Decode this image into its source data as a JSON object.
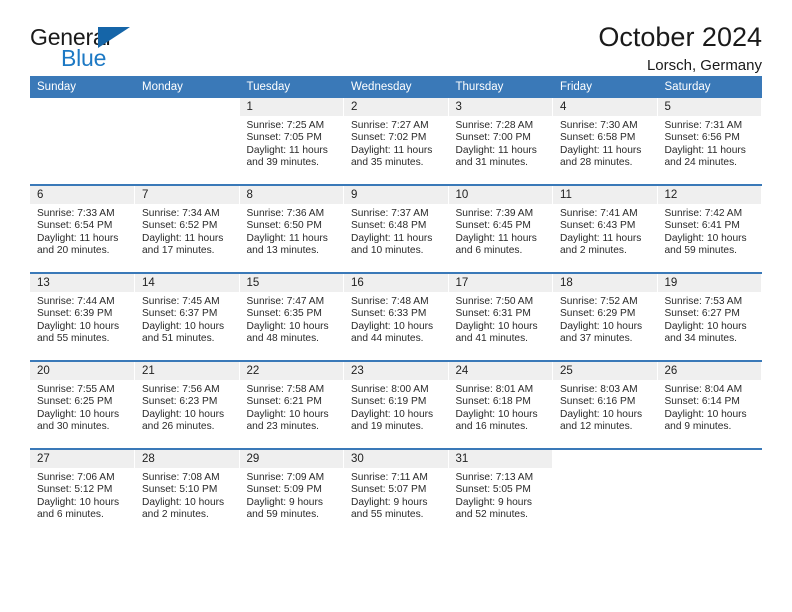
{
  "brand": {
    "name_part1": "General",
    "name_part2": "Blue",
    "triangle_icon": "triangle-logo-icon",
    "accent_color": "#1d79c4",
    "header_bar_color": "#3a79b8"
  },
  "header": {
    "title": "October 2024",
    "location": "Lorsch, Germany"
  },
  "weekdays": [
    "Sunday",
    "Monday",
    "Tuesday",
    "Wednesday",
    "Thursday",
    "Friday",
    "Saturday"
  ],
  "labels": {
    "sunrise_prefix": "Sunrise:",
    "sunset_prefix": "Sunset:",
    "daylight_prefix": "Daylight:"
  },
  "weeks": [
    [
      {
        "day": "",
        "blank": true
      },
      {
        "day": "",
        "blank": true
      },
      {
        "day": "1",
        "sunrise": "Sunrise: 7:25 AM",
        "sunset": "Sunset: 7:05 PM",
        "daylight": "Daylight: 11 hours and 39 minutes."
      },
      {
        "day": "2",
        "sunrise": "Sunrise: 7:27 AM",
        "sunset": "Sunset: 7:02 PM",
        "daylight": "Daylight: 11 hours and 35 minutes."
      },
      {
        "day": "3",
        "sunrise": "Sunrise: 7:28 AM",
        "sunset": "Sunset: 7:00 PM",
        "daylight": "Daylight: 11 hours and 31 minutes."
      },
      {
        "day": "4",
        "sunrise": "Sunrise: 7:30 AM",
        "sunset": "Sunset: 6:58 PM",
        "daylight": "Daylight: 11 hours and 28 minutes."
      },
      {
        "day": "5",
        "sunrise": "Sunrise: 7:31 AM",
        "sunset": "Sunset: 6:56 PM",
        "daylight": "Daylight: 11 hours and 24 minutes."
      }
    ],
    [
      {
        "day": "6",
        "sunrise": "Sunrise: 7:33 AM",
        "sunset": "Sunset: 6:54 PM",
        "daylight": "Daylight: 11 hours and 20 minutes."
      },
      {
        "day": "7",
        "sunrise": "Sunrise: 7:34 AM",
        "sunset": "Sunset: 6:52 PM",
        "daylight": "Daylight: 11 hours and 17 minutes."
      },
      {
        "day": "8",
        "sunrise": "Sunrise: 7:36 AM",
        "sunset": "Sunset: 6:50 PM",
        "daylight": "Daylight: 11 hours and 13 minutes."
      },
      {
        "day": "9",
        "sunrise": "Sunrise: 7:37 AM",
        "sunset": "Sunset: 6:48 PM",
        "daylight": "Daylight: 11 hours and 10 minutes."
      },
      {
        "day": "10",
        "sunrise": "Sunrise: 7:39 AM",
        "sunset": "Sunset: 6:45 PM",
        "daylight": "Daylight: 11 hours and 6 minutes."
      },
      {
        "day": "11",
        "sunrise": "Sunrise: 7:41 AM",
        "sunset": "Sunset: 6:43 PM",
        "daylight": "Daylight: 11 hours and 2 minutes."
      },
      {
        "day": "12",
        "sunrise": "Sunrise: 7:42 AM",
        "sunset": "Sunset: 6:41 PM",
        "daylight": "Daylight: 10 hours and 59 minutes."
      }
    ],
    [
      {
        "day": "13",
        "sunrise": "Sunrise: 7:44 AM",
        "sunset": "Sunset: 6:39 PM",
        "daylight": "Daylight: 10 hours and 55 minutes."
      },
      {
        "day": "14",
        "sunrise": "Sunrise: 7:45 AM",
        "sunset": "Sunset: 6:37 PM",
        "daylight": "Daylight: 10 hours and 51 minutes."
      },
      {
        "day": "15",
        "sunrise": "Sunrise: 7:47 AM",
        "sunset": "Sunset: 6:35 PM",
        "daylight": "Daylight: 10 hours and 48 minutes."
      },
      {
        "day": "16",
        "sunrise": "Sunrise: 7:48 AM",
        "sunset": "Sunset: 6:33 PM",
        "daylight": "Daylight: 10 hours and 44 minutes."
      },
      {
        "day": "17",
        "sunrise": "Sunrise: 7:50 AM",
        "sunset": "Sunset: 6:31 PM",
        "daylight": "Daylight: 10 hours and 41 minutes."
      },
      {
        "day": "18",
        "sunrise": "Sunrise: 7:52 AM",
        "sunset": "Sunset: 6:29 PM",
        "daylight": "Daylight: 10 hours and 37 minutes."
      },
      {
        "day": "19",
        "sunrise": "Sunrise: 7:53 AM",
        "sunset": "Sunset: 6:27 PM",
        "daylight": "Daylight: 10 hours and 34 minutes."
      }
    ],
    [
      {
        "day": "20",
        "sunrise": "Sunrise: 7:55 AM",
        "sunset": "Sunset: 6:25 PM",
        "daylight": "Daylight: 10 hours and 30 minutes."
      },
      {
        "day": "21",
        "sunrise": "Sunrise: 7:56 AM",
        "sunset": "Sunset: 6:23 PM",
        "daylight": "Daylight: 10 hours and 26 minutes."
      },
      {
        "day": "22",
        "sunrise": "Sunrise: 7:58 AM",
        "sunset": "Sunset: 6:21 PM",
        "daylight": "Daylight: 10 hours and 23 minutes."
      },
      {
        "day": "23",
        "sunrise": "Sunrise: 8:00 AM",
        "sunset": "Sunset: 6:19 PM",
        "daylight": "Daylight: 10 hours and 19 minutes."
      },
      {
        "day": "24",
        "sunrise": "Sunrise: 8:01 AM",
        "sunset": "Sunset: 6:18 PM",
        "daylight": "Daylight: 10 hours and 16 minutes."
      },
      {
        "day": "25",
        "sunrise": "Sunrise: 8:03 AM",
        "sunset": "Sunset: 6:16 PM",
        "daylight": "Daylight: 10 hours and 12 minutes."
      },
      {
        "day": "26",
        "sunrise": "Sunrise: 8:04 AM",
        "sunset": "Sunset: 6:14 PM",
        "daylight": "Daylight: 10 hours and 9 minutes."
      }
    ],
    [
      {
        "day": "27",
        "sunrise": "Sunrise: 7:06 AM",
        "sunset": "Sunset: 5:12 PM",
        "daylight": "Daylight: 10 hours and 6 minutes."
      },
      {
        "day": "28",
        "sunrise": "Sunrise: 7:08 AM",
        "sunset": "Sunset: 5:10 PM",
        "daylight": "Daylight: 10 hours and 2 minutes."
      },
      {
        "day": "29",
        "sunrise": "Sunrise: 7:09 AM",
        "sunset": "Sunset: 5:09 PM",
        "daylight": "Daylight: 9 hours and 59 minutes."
      },
      {
        "day": "30",
        "sunrise": "Sunrise: 7:11 AM",
        "sunset": "Sunset: 5:07 PM",
        "daylight": "Daylight: 9 hours and 55 minutes."
      },
      {
        "day": "31",
        "sunrise": "Sunrise: 7:13 AM",
        "sunset": "Sunset: 5:05 PM",
        "daylight": "Daylight: 9 hours and 52 minutes."
      },
      {
        "day": "",
        "blank": true
      },
      {
        "day": "",
        "blank": true
      }
    ]
  ]
}
